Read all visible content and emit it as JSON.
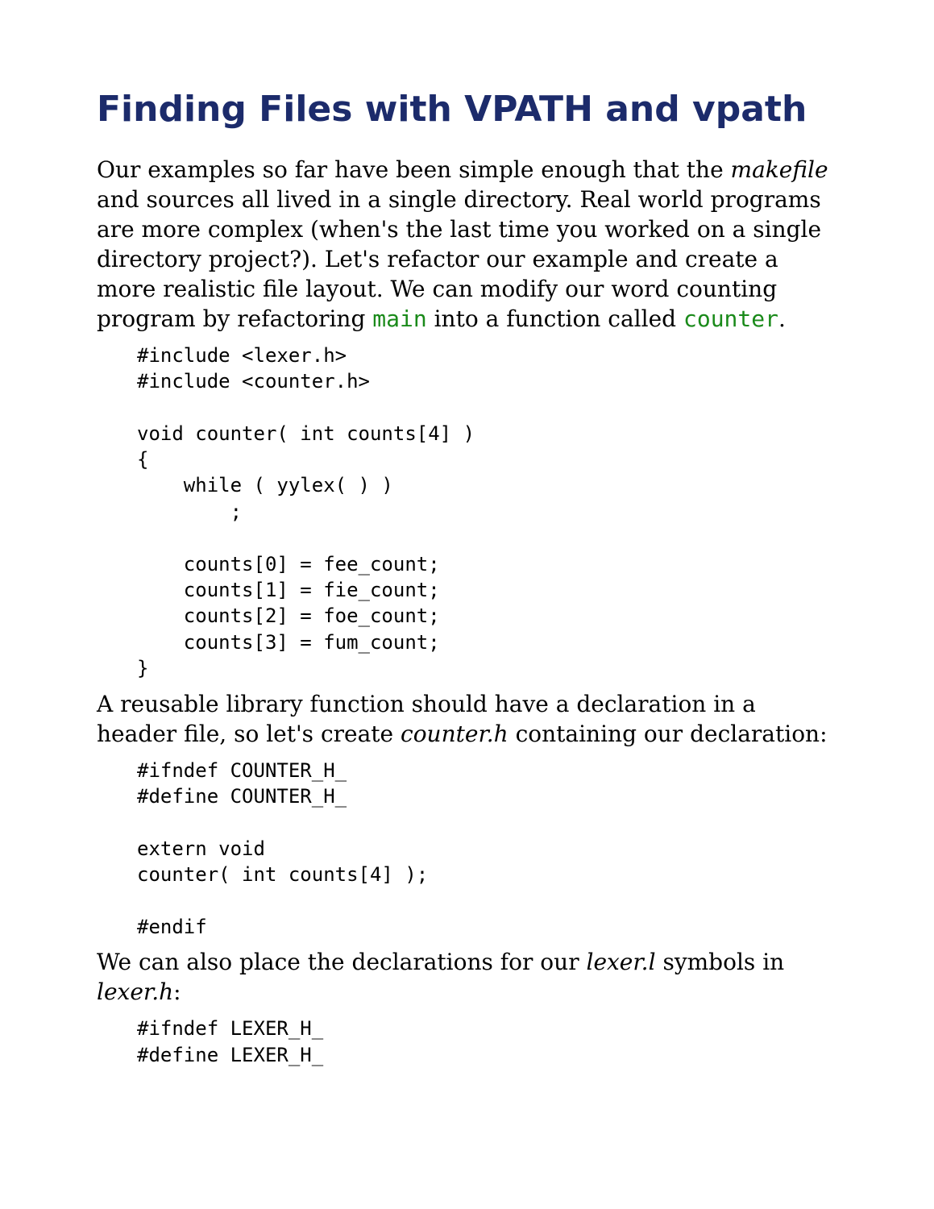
{
  "heading": "Finding Files with VPATH and vpath",
  "para1": {
    "t1": "Our examples so far have been simple enough that the ",
    "makefile": "makefile",
    "t2": " and sources all lived in a single directory. Real world programs are more complex (when's the last time you worked on a single directory project?). Let's refactor our example and create a more realistic file layout. We can modify our word counting program by refactoring ",
    "main": "main",
    "t3": " into a function called ",
    "counter": "counter",
    "t4": "."
  },
  "code1": "#include <lexer.h>\n#include <counter.h>\n\nvoid counter( int counts[4] )\n{\n    while ( yylex( ) )\n        ;\n\n    counts[0] = fee_count;\n    counts[1] = fie_count;\n    counts[2] = foe_count;\n    counts[3] = fum_count;\n}",
  "para2": {
    "t1": "A reusable library function should have a declaration in a header file, so let's create ",
    "counter_h": "counter.h",
    "t2": " containing our declaration:"
  },
  "code2": "#ifndef COUNTER_H_\n#define COUNTER_H_\n\nextern void\ncounter( int counts[4] );\n\n#endif",
  "para3": {
    "t1": "We can also place the declarations for our ",
    "lexer_l": "lexer.l",
    "t2": " symbols in ",
    "lexer_h": "lexer.h",
    "t3": ":"
  },
  "code3": "#ifndef LEXER_H_\n#define LEXER_H_"
}
